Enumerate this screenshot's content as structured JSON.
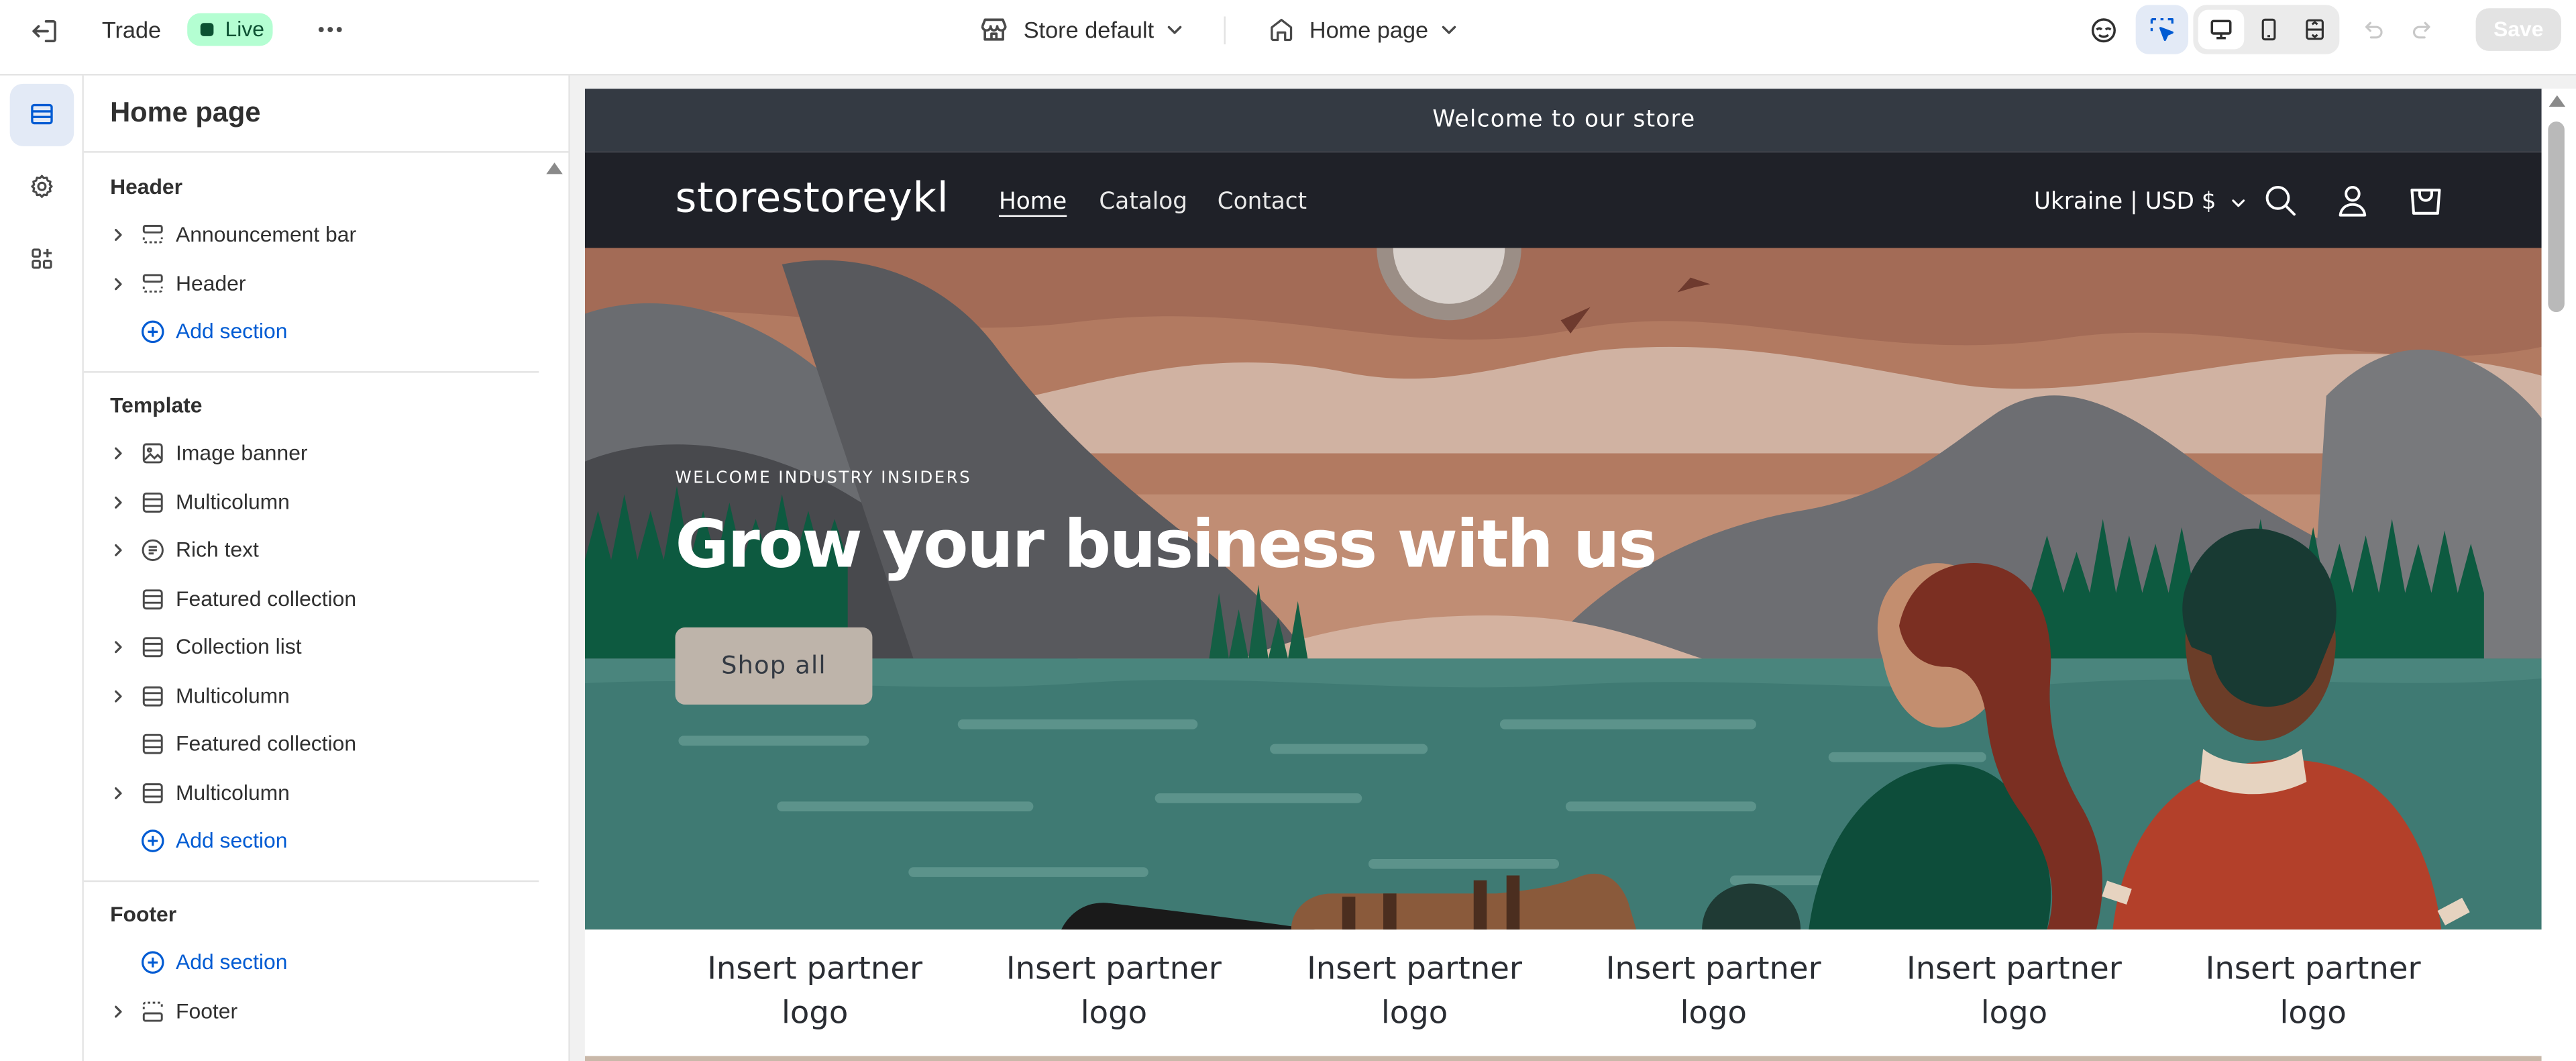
{
  "topbar": {
    "exit_icon": "exit-icon",
    "app_name": "Trade",
    "status_badge": "Live",
    "more_icon": "more-horizontal-icon",
    "store_selector": "Store default",
    "page_selector": "Home page",
    "save_label": "Save"
  },
  "rail": {
    "items": [
      "sections-icon",
      "settings-icon",
      "apps-icon"
    ]
  },
  "panel": {
    "title": "Home page",
    "groups": [
      {
        "heading": "Header",
        "items": [
          "Announcement bar",
          "Header"
        ],
        "add": "Add section"
      },
      {
        "heading": "Template",
        "items": [
          "Image banner",
          "Multicolumn",
          "Rich text",
          "Featured collection",
          "Collection list",
          "Multicolumn",
          "Featured collection",
          "Multicolumn"
        ],
        "add": "Add section"
      },
      {
        "heading": "Footer",
        "add": "Add section",
        "items": [
          "Footer"
        ]
      }
    ]
  },
  "site": {
    "announcement": "Welcome to our store",
    "logo": "storestoreykl",
    "nav": [
      "Home",
      "Catalog",
      "Contact"
    ],
    "locale": "Ukraine | USD $",
    "hero": {
      "kicker": "WELCOME INDUSTRY INSIDERS",
      "headline": "Grow your business with us",
      "button": "Shop all"
    },
    "partner_logos": [
      "Insert partner logo",
      "Insert partner logo",
      "Insert partner logo",
      "Insert partner logo",
      "Insert partner logo",
      "Insert partner logo"
    ]
  },
  "colors": {
    "accent": "#005bd3",
    "live_bg": "#b4fed2",
    "announcement_bg": "#343a43",
    "header_bg": "#1f2128"
  }
}
